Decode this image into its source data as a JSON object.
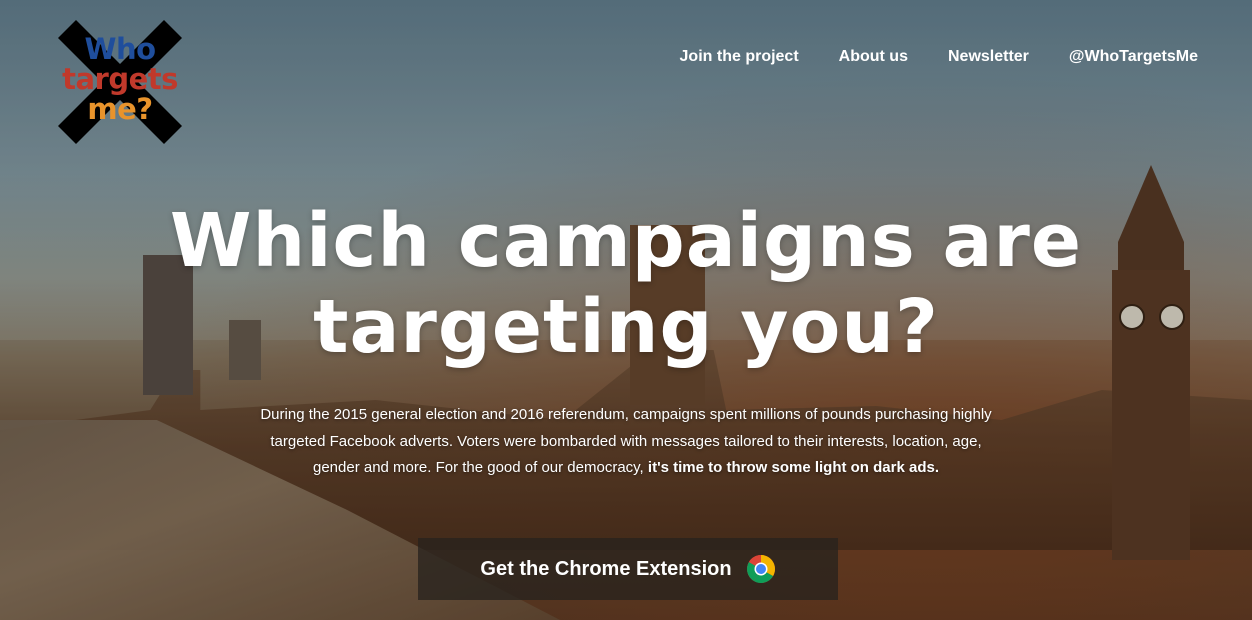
{
  "logo": {
    "line1": "Who",
    "line2": "targets",
    "line3": "me?",
    "colors": {
      "cross": "#000000",
      "who": "#1f4e9c",
      "targets": "#c0392b",
      "me": "#e8932b"
    }
  },
  "nav": {
    "items": [
      {
        "label": "Join the project"
      },
      {
        "label": "About us"
      },
      {
        "label": "Newsletter"
      },
      {
        "label": "@WhoTargetsMe"
      }
    ]
  },
  "hero": {
    "headline_line1": "Which campaigns are",
    "headline_line2": "targeting you?",
    "intro_text": "During the 2015 general election and 2016 referendum, campaigns spent millions of pounds purchasing highly targeted Facebook adverts. Voters were bombarded with messages tailored to their interests, location, age, gender and more. For the good of our democracy, ",
    "intro_emphasis": "it's time to throw some light on dark ads",
    "intro_end": "."
  },
  "cta": {
    "label": "Get the Chrome Extension",
    "icon": "chrome-icon"
  }
}
